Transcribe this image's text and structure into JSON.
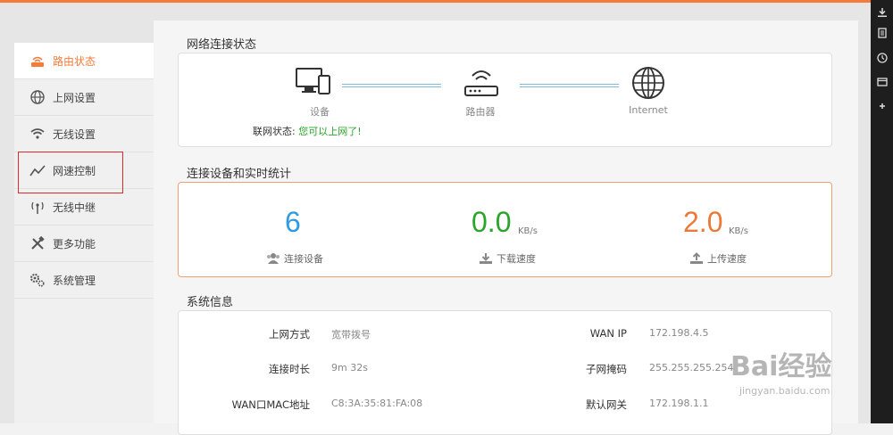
{
  "sidebar": {
    "items": [
      {
        "label": "路由状态",
        "icon": "router-icon",
        "active": true
      },
      {
        "label": "上网设置",
        "icon": "globe-icon"
      },
      {
        "label": "无线设置",
        "icon": "wifi-icon"
      },
      {
        "label": "网速控制",
        "icon": "speed-chart-icon"
      },
      {
        "label": "无线中继",
        "icon": "antenna-icon"
      },
      {
        "label": "更多功能",
        "icon": "tools-icon"
      },
      {
        "label": "系统管理",
        "icon": "gears-icon"
      }
    ]
  },
  "network_status": {
    "title": "网络连接状态",
    "device_label": "设备",
    "router_label": "路由器",
    "internet_label": "Internet",
    "status_key": "联网状态:",
    "status_value": "您可以上网了!"
  },
  "stats": {
    "title": "连接设备和实时统计",
    "devices": {
      "value": "6",
      "label": "连接设备"
    },
    "download": {
      "value": "0.0",
      "unit": "KB/s",
      "label": "下载速度"
    },
    "upload": {
      "value": "2.0",
      "unit": "KB/s",
      "label": "上传速度"
    }
  },
  "system_info": {
    "title": "系统信息",
    "left": [
      {
        "key": "上网方式",
        "value": "宽带拨号"
      },
      {
        "key": "连接时长",
        "value": "9m 32s"
      },
      {
        "key": "WAN口MAC地址",
        "value": "C8:3A:35:81:FA:08"
      }
    ],
    "right": [
      {
        "key": "WAN IP",
        "value": "172.198.4.5"
      },
      {
        "key": "子网掩码",
        "value": "255.255.255.254"
      },
      {
        "key": "默认网关",
        "value": "172.198.1.1"
      }
    ]
  },
  "watermark": {
    "brand": "Bai经验",
    "url": "jingyan.baidu.com"
  },
  "colors": {
    "accent": "#f47b3a",
    "blue": "#2f9be0",
    "green": "#2aa52a",
    "orange": "#ea7a3a",
    "ok": "#2aa52a"
  }
}
